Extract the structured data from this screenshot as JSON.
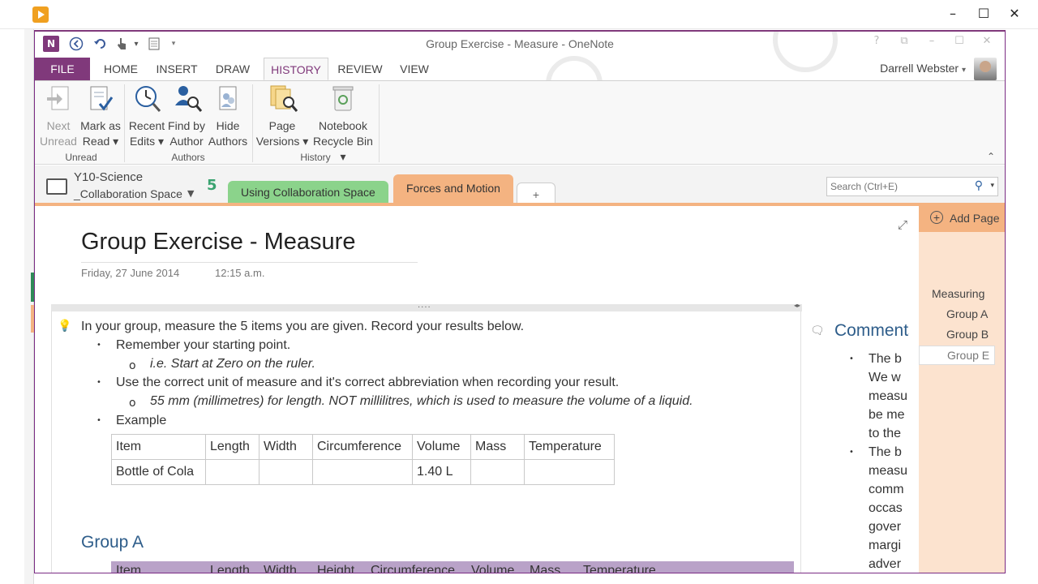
{
  "window": {
    "title": "Group Exercise - Measure - OneNote",
    "onenote_logo": "N",
    "outer_controls": [
      "–",
      "☐",
      "✕"
    ],
    "controls": [
      "?",
      "⧉",
      "–",
      "☐",
      "✕"
    ]
  },
  "qat": {
    "back_icon": "back-circle-icon",
    "undo_icon": "undo-icon",
    "touch_icon": "touch-mode-icon",
    "dropdown_caret": "▾",
    "layout_icon": "page-layout-icon",
    "customize_caret": "▾"
  },
  "tabs": [
    {
      "label": "FILE",
      "kind": "file"
    },
    {
      "label": "HOME"
    },
    {
      "label": "INSERT"
    },
    {
      "label": "DRAW"
    },
    {
      "label": "HISTORY",
      "active": true
    },
    {
      "label": "REVIEW"
    },
    {
      "label": "VIEW"
    }
  ],
  "user": {
    "name": "Darrell Webster",
    "caret": "▾"
  },
  "ribbon": {
    "next_unread": [
      "Next",
      "Unread"
    ],
    "mark_as_read": [
      "Mark as",
      "Read ▾"
    ],
    "recent_edits": [
      "Recent",
      "Edits ▾"
    ],
    "find_by_author": [
      "Find by",
      "Author"
    ],
    "hide_authors": [
      "Hide",
      "Authors"
    ],
    "page_versions": [
      "Page",
      "Versions ▾"
    ],
    "notebook_recycle_bin": [
      "Notebook",
      "Recycle Bin ▾"
    ],
    "group_unread": "Unread",
    "group_authors": "Authors",
    "group_history": "History",
    "collapse_glyph": "⌃"
  },
  "notebook": {
    "name": "Y10-Science",
    "section_group": "_Collaboration Space",
    "dropdown": "▼",
    "sync_glyph": "5"
  },
  "sections": {
    "green": "Using Collaboration Space",
    "orange": "Forces and Motion",
    "new": "+"
  },
  "search": {
    "placeholder": "Search (Ctrl+E)",
    "icon_glyph": "⚲",
    "dropdown": "▾"
  },
  "page": {
    "title": "Group Exercise - Measure",
    "date": "Friday, 27 June 2014",
    "time": "12:15 a.m.",
    "expand_glyph": "⤢",
    "outline_handle": "....",
    "outline_arrows": "◂▸",
    "tip_glyph": "💡",
    "intro": "In your group, measure the 5 items you are given. Record your results below.",
    "bullet1": "Remember your starting point.",
    "sub1": "i.e. Start at Zero on the ruler.",
    "bullet2": "Use the correct unit of measure and it's correct abbreviation when recording your result.",
    "sub2": "55 mm (millimetres) for length. NOT millilitres, which is used to measure the volume of a liquid.",
    "bullet3": "Example",
    "bullet_glyph": "•",
    "sub_bullet_glyph": "o",
    "group_a_heading": "Group A"
  },
  "example_table": {
    "headers": [
      "Item",
      "Length",
      "Width",
      "Circumference",
      "Volume",
      "Mass",
      "Temperature"
    ],
    "rows": [
      [
        "Bottle of Cola",
        "",
        "",
        "",
        "1.40 L",
        "",
        ""
      ]
    ]
  },
  "group_a_table_headers": [
    "Item",
    "Length",
    "Width",
    "Height",
    "Circumference",
    "Volume",
    "Mass",
    "Temperature"
  ],
  "comments": {
    "title": "Comments",
    "icon_glyph": "🗨",
    "lines": [
      "The b",
      "We w",
      "measu",
      "be me",
      "to the",
      "The b",
      "measu",
      "comm",
      "occas",
      "gover",
      "margi",
      "adver"
    ]
  },
  "pages": {
    "add_label": "Add Page",
    "add_glyph": "+",
    "items": [
      "Measuring",
      "Group A",
      "Group B",
      "Group E"
    ],
    "selected": "Group E"
  },
  "colors": {
    "onenote_purple": "#80397B",
    "section_green": "#8BD38B",
    "section_orange": "#F4B381",
    "heading_blue": "#2E5D8A",
    "group_table_header": "#B9A2C8"
  }
}
